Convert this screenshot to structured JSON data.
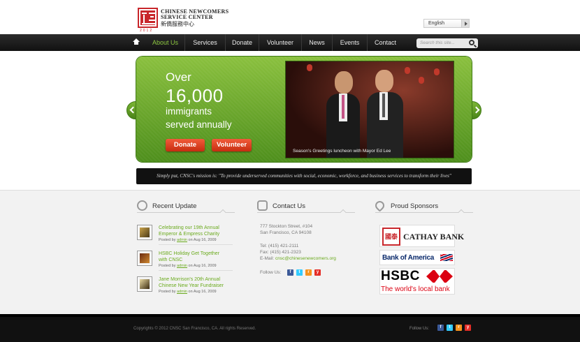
{
  "header": {
    "logo_line1": "CHINESE NEWCOMERS",
    "logo_line2": "SERVICE CENTER",
    "logo_chinese": "新僑服務中心",
    "logo_year": "2012",
    "language": "English"
  },
  "nav": {
    "items": [
      {
        "label": "About Us"
      },
      {
        "label": "Services"
      },
      {
        "label": "Donate"
      },
      {
        "label": "Volunteer"
      },
      {
        "label": "News"
      },
      {
        "label": "Events"
      },
      {
        "label": "Contact"
      }
    ],
    "search_placeholder": "Search this site..."
  },
  "hero": {
    "line1": "Over",
    "line2": "16,000",
    "line3": "immigrants",
    "line4": "served annually",
    "donate": "Donate",
    "volunteer": "Volunteer",
    "caption": "Season's Greetings luncheon with Mayor Ed Lee"
  },
  "mission": "Simply put, CNSC's mission is: \"To provide underserved communities with social, economic, workforce, and business services to transform their lives\"",
  "recent": {
    "heading": "Recent Update",
    "items": [
      {
        "title_a": "Celebrating our 19th Annual",
        "title_b": "Emperor & Empress Charity",
        "posted": "Posted by",
        "author": "admin",
        "date": "on Aug 16, 2009"
      },
      {
        "title_a": "HSBC Holiday Get Together",
        "title_b": "with CNSC",
        "posted": "Posted by",
        "author": "admin",
        "date": "on Aug 16, 2009"
      },
      {
        "title_a": "Jane Morrison's 20th Annual",
        "title_b": "Chinese New Year Fundraiser",
        "posted": "Posted by",
        "author": "admin",
        "date": "on Aug 16, 2009"
      }
    ]
  },
  "contact": {
    "heading": "Contact Us",
    "address1": "777 Stockton Street, #104",
    "address2": "San Francisco, CA 94108",
    "tel": "Tel: (415) 421-2111",
    "fax": "Fax: (415) 421-2323",
    "email_label": "E-Mail:",
    "email": "cnsc@chinesenewcomers.org",
    "follow": "Follow Us:"
  },
  "sponsors": {
    "heading": "Proud Sponsors",
    "cathay": "CATHAY BANK",
    "cathay_seal": "國泰",
    "boa": "Bank of America",
    "hsbc": "HSBC",
    "hsbc_tag": "The world's local bank"
  },
  "footer": {
    "copyright": "Copyrights © 2012 CNSC San Francisco, CA. All rights Reserved.",
    "follow": "Follow Us:"
  },
  "social": {
    "fb": "f",
    "tw": "t",
    "rss": "r",
    "yt": "y"
  },
  "colors": {
    "accent_green": "#6aaa1d",
    "nav_active": "#8cc63f",
    "button_red": "#e0461f",
    "nav_bg": "#1c1c1c"
  }
}
